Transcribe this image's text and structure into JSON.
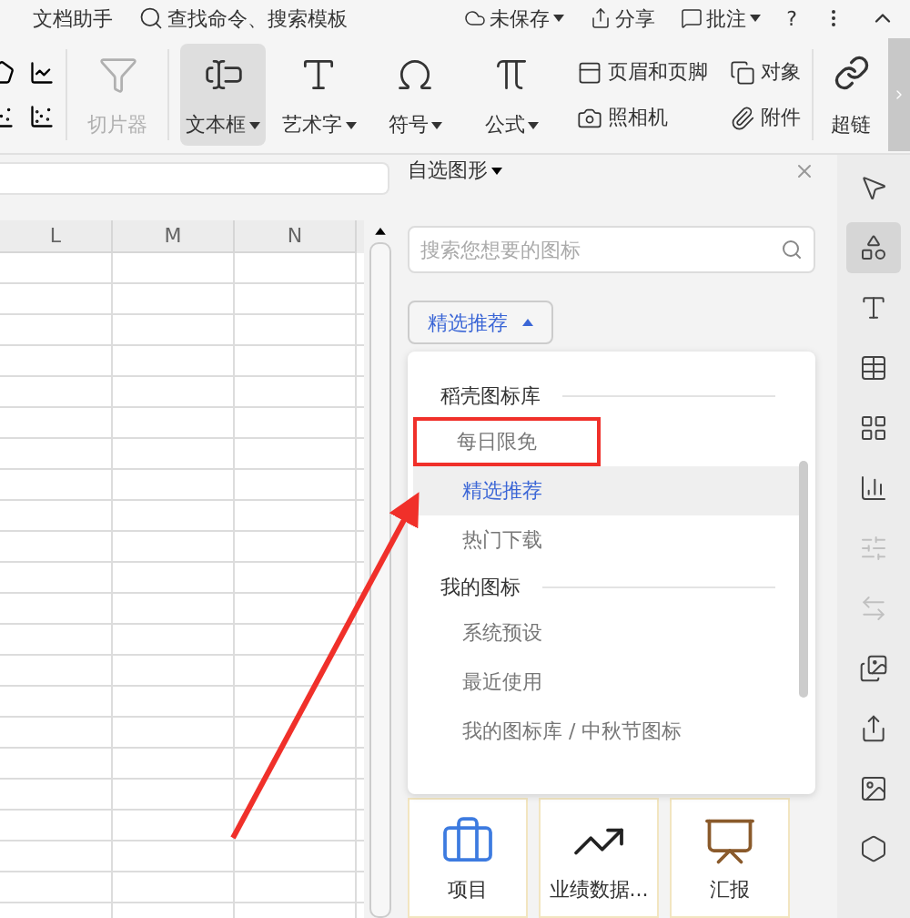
{
  "topbar": {
    "left": [
      {
        "kind": "text",
        "label": "文档助手"
      },
      {
        "kind": "search",
        "label": "查找命令、搜索模板"
      }
    ],
    "right": [
      {
        "kind": "cloud",
        "label": "未保存",
        "caret": true
      },
      {
        "kind": "share",
        "label": "分享",
        "caret": false
      },
      {
        "kind": "comment",
        "label": "批注",
        "caret": true
      }
    ],
    "help": "?"
  },
  "ribbon": {
    "large": [
      {
        "kind": "slicer",
        "label": "切片器",
        "disabled": true,
        "selected": false,
        "caret": false
      },
      {
        "kind": "textbox",
        "label": "文本框",
        "disabled": false,
        "selected": true,
        "caret": true
      },
      {
        "kind": "wordart",
        "label": "艺术字",
        "disabled": false,
        "selected": false,
        "caret": true
      },
      {
        "kind": "symbol",
        "label": "符号",
        "disabled": false,
        "selected": false,
        "caret": true
      },
      {
        "kind": "formula",
        "label": "公式",
        "disabled": false,
        "selected": false,
        "caret": true
      }
    ],
    "small": [
      {
        "kind": "header",
        "label": "页眉和页脚"
      },
      {
        "kind": "object",
        "label": "对象"
      },
      {
        "kind": "camera",
        "label": "照相机"
      },
      {
        "kind": "attach",
        "label": "附件"
      }
    ],
    "link": {
      "label": "超链"
    }
  },
  "sheet": {
    "columns": [
      "L",
      "M",
      "N"
    ]
  },
  "panel": {
    "title": "自选图形",
    "search": {
      "placeholder": "搜索您想要的图标"
    },
    "dropdown": {
      "label": "精选推荐",
      "expanded": true
    },
    "menu": [
      {
        "title": "稻壳图标库",
        "items": [
          {
            "label": "每日限免",
            "selected": false,
            "boxed": true
          },
          {
            "label": "精选推荐",
            "selected": true,
            "boxed": false
          },
          {
            "label": "热门下载",
            "selected": false,
            "boxed": false
          }
        ]
      },
      {
        "title": "我的图标",
        "items": [
          {
            "label": "系统预设",
            "selected": false,
            "boxed": false
          },
          {
            "label": "最近使用",
            "selected": false,
            "boxed": false
          },
          {
            "label": "我的图标库 / 中秋节图标",
            "selected": false,
            "boxed": false
          }
        ]
      }
    ],
    "cards": [
      {
        "kind": "toolbox",
        "label": "项目"
      },
      {
        "kind": "growth",
        "label": "业绩数据..."
      },
      {
        "kind": "report",
        "label": "汇报"
      }
    ]
  },
  "sidebar": [
    {
      "kind": "pointer",
      "selected": false,
      "disabled": false
    },
    {
      "kind": "shapes",
      "selected": true,
      "disabled": false
    },
    {
      "kind": "wordart",
      "selected": false,
      "disabled": false
    },
    {
      "kind": "table",
      "selected": false,
      "disabled": false
    },
    {
      "kind": "grid",
      "selected": false,
      "disabled": false
    },
    {
      "kind": "chart",
      "selected": false,
      "disabled": false
    },
    {
      "kind": "sliders",
      "selected": false,
      "disabled": true
    },
    {
      "kind": "swap",
      "selected": false,
      "disabled": true
    },
    {
      "kind": "gallery",
      "selected": false,
      "disabled": false
    },
    {
      "kind": "share",
      "selected": false,
      "disabled": false
    },
    {
      "kind": "image",
      "selected": false,
      "disabled": false
    },
    {
      "kind": "hexagon",
      "selected": false,
      "disabled": false
    }
  ]
}
